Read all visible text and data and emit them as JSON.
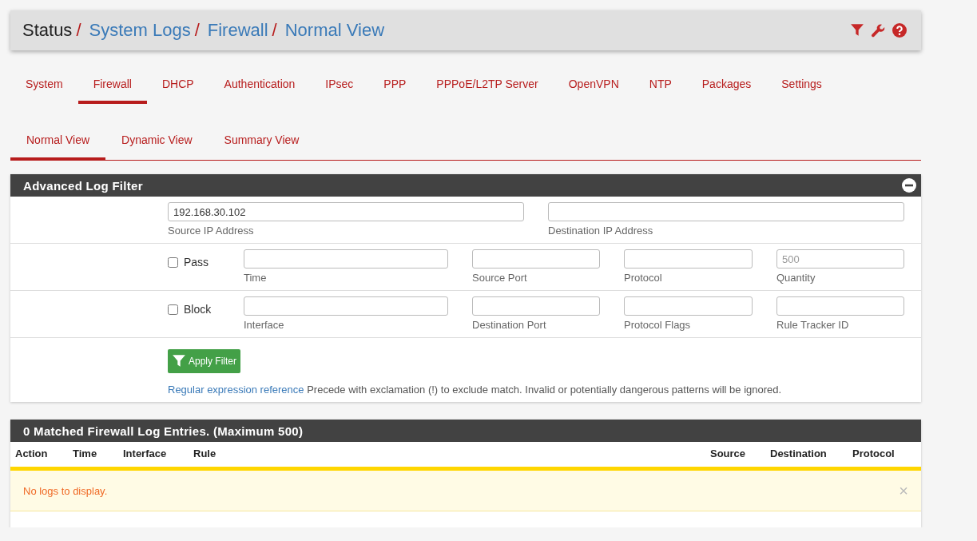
{
  "breadcrumb": [
    {
      "label": "Status",
      "link": false
    },
    {
      "separator": "/",
      "label": "System Logs",
      "link": true
    },
    {
      "separator": "/",
      "label": "Firewall",
      "link": true
    },
    {
      "separator": "/",
      "label": "Normal View",
      "link": true
    }
  ],
  "tabs": [
    {
      "label": "System",
      "selected": false
    },
    {
      "label": "Firewall",
      "selected": true
    },
    {
      "label": "DHCP",
      "selected": false
    },
    {
      "label": "Authentication",
      "selected": false
    },
    {
      "label": "IPsec",
      "selected": false
    },
    {
      "label": "PPP",
      "selected": false
    },
    {
      "label": "PPPoE/L2TP Server",
      "selected": false
    },
    {
      "label": "OpenVPN",
      "selected": false
    },
    {
      "label": "NTP",
      "selected": false
    },
    {
      "label": "Packages",
      "selected": false
    },
    {
      "label": "Settings",
      "selected": false
    }
  ],
  "subtabs": [
    {
      "label": "Normal View",
      "selected": true
    },
    {
      "label": "Dynamic View",
      "selected": false
    },
    {
      "label": "Summary View",
      "selected": false
    }
  ],
  "filter": {
    "title": "Advanced Log Filter",
    "expanded": true,
    "rows": [
      {
        "checkbox": null,
        "fields": [
          {
            "label": "Source IP Address",
            "value": "192.168.30.102"
          },
          {
            "label": "Destination IP Address"
          }
        ]
      },
      {
        "checkbox": {
          "label": "Pass",
          "checked": false
        },
        "fields": [
          {
            "label": "Time"
          },
          {
            "label": "Source Port"
          },
          {
            "label": "Protocol"
          },
          {
            "label": "Quantity",
            "placeholder": "500"
          }
        ]
      },
      {
        "checkbox": {
          "label": "Block",
          "checked": false
        },
        "fields": [
          {
            "label": "Interface"
          },
          {
            "label": "Destination Port"
          },
          {
            "label": "Protocol Flags"
          },
          {
            "label": "Rule Tracker ID"
          }
        ]
      }
    ],
    "button": "Apply Filter",
    "help_link": "Regular expression reference",
    "help_text": "Precede with exclamation (!) to exclude match. Invalid or potentially dangerous patterns will be ignored."
  },
  "log": {
    "title": "0 Matched Firewall Log Entries. (Maximum 500)",
    "columns": [
      "Action",
      "Time",
      "Interface",
      "Rule",
      "Source",
      "Destination",
      "Protocol"
    ],
    "message": "No logs to display.",
    "close": "×"
  }
}
